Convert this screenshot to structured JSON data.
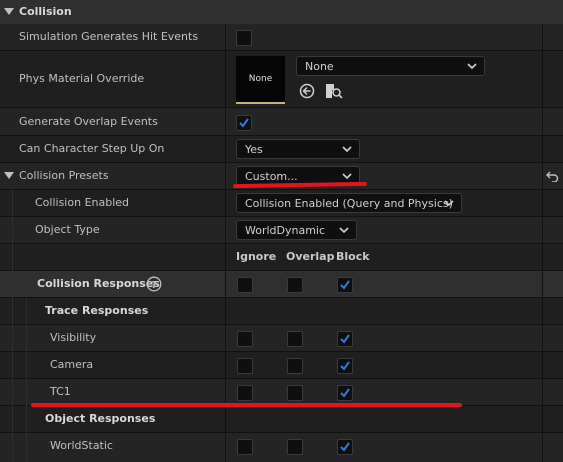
{
  "section": {
    "title": "Collision"
  },
  "rows": {
    "sim_hit_events": {
      "label": "Simulation Generates Hit Events",
      "checked": false
    },
    "phys_material": {
      "label": "Phys Material Override",
      "thumb_text": "None",
      "value": "None"
    },
    "overlap_events": {
      "label": "Generate Overlap Events",
      "checked": true
    },
    "step_up": {
      "label": "Can Character Step Up On",
      "value": "Yes"
    },
    "presets": {
      "label": "Collision Presets",
      "value": "Custom..."
    },
    "collision_enabled": {
      "label": "Collision Enabled",
      "value": "Collision Enabled (Query and Physics)"
    },
    "object_type": {
      "label": "Object Type",
      "value": "WorldDynamic"
    }
  },
  "columns": {
    "ignore": "Ignore",
    "overlap": "Overlap",
    "block": "Block"
  },
  "responses": {
    "title": "Collision Responses",
    "trace_title": "Trace Responses",
    "object_title": "Object Responses",
    "items": [
      {
        "label": "Visibility",
        "ignore": false,
        "overlap": false,
        "block": true
      },
      {
        "label": "Camera",
        "ignore": false,
        "overlap": false,
        "block": true
      },
      {
        "label": "TC1",
        "ignore": false,
        "overlap": false,
        "block": true
      },
      {
        "label": "WorldStatic",
        "ignore": false,
        "overlap": false,
        "block": true
      }
    ],
    "all": {
      "ignore": false,
      "overlap": false,
      "block": true
    }
  },
  "colors": {
    "accent": "#2b7de0",
    "annotation": "#e3141b"
  },
  "icons": [
    "expand-arrow-icon",
    "use-selected-icon",
    "browse-asset-icon",
    "reset-to-default-icon",
    "help-icon",
    "chevron-down-icon",
    "checkmark-icon"
  ]
}
